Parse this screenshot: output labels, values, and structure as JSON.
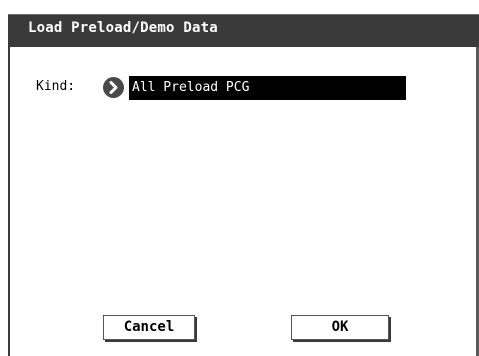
{
  "dialog": {
    "title": "Load Preload/Demo Data"
  },
  "kind": {
    "label": "Kind:",
    "value": "All Preload PCG",
    "arrow_icon": "chevron-right-icon"
  },
  "buttons": {
    "cancel": "Cancel",
    "ok": "OK"
  },
  "colors": {
    "titlebar": "#3a3a3a",
    "title_text": "#ffffff",
    "selected_field": "#000000",
    "selected_text": "#ffffff",
    "arrow_button": "#4a4a4a"
  }
}
